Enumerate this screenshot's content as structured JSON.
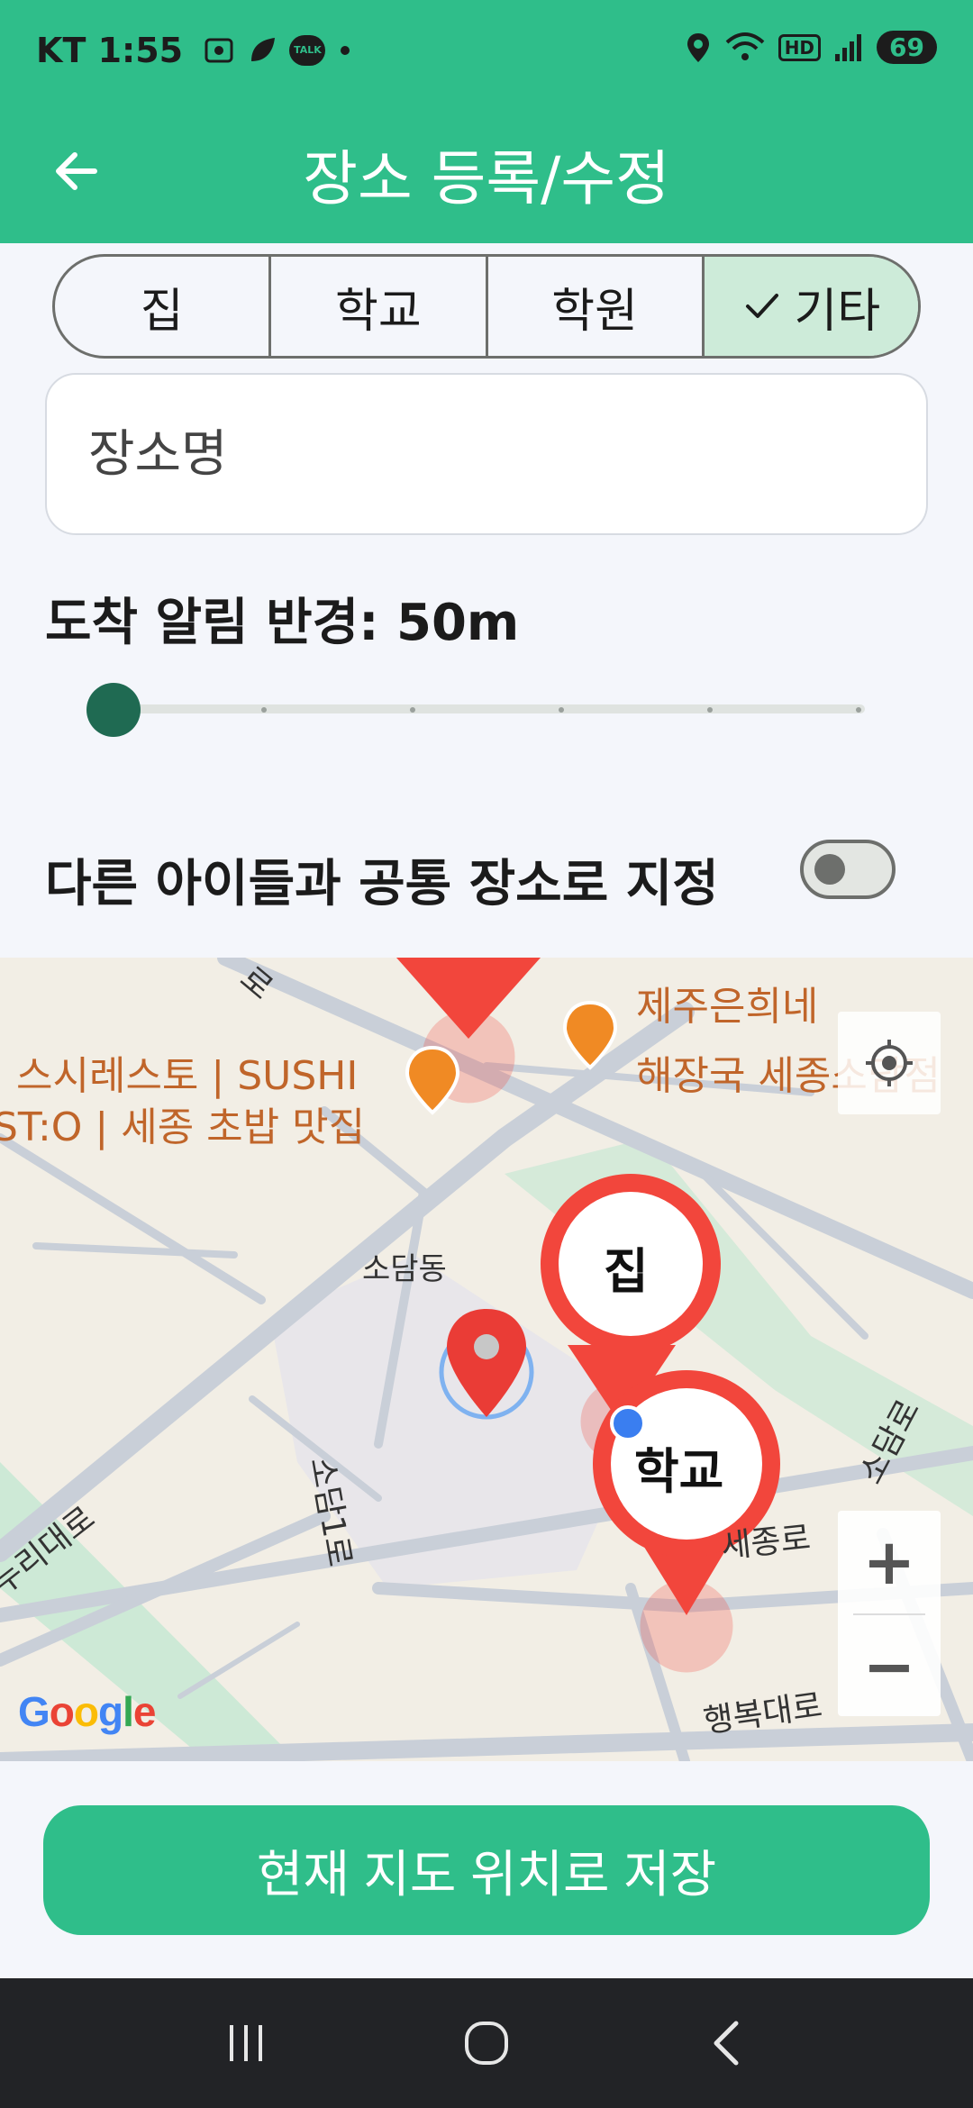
{
  "status_bar": {
    "carrier_time": "KT 1:55",
    "talk_badge": "TALK",
    "battery": "69",
    "hd_label": "HD"
  },
  "app_bar": {
    "title": "장소 등록/수정"
  },
  "segments": [
    {
      "label": "집",
      "selected": false
    },
    {
      "label": "학교",
      "selected": false
    },
    {
      "label": "학원",
      "selected": false
    },
    {
      "label": "기타",
      "selected": true
    }
  ],
  "name_field": {
    "placeholder": "장소명",
    "value": ""
  },
  "radius": {
    "label": "도착 알림 반경: 50m",
    "slider_fraction": 0.0
  },
  "share": {
    "label": "다른 아이들과 공통 장소로 지정",
    "enabled": false
  },
  "map": {
    "places": [
      {
        "name": "스시레스토 | SUSHI"
      },
      {
        "name": "ST:O | 세종 초밥 맛집"
      },
      {
        "name": "제주은희네"
      },
      {
        "name": "해장국 세종소담점"
      }
    ],
    "area_label": "소담동",
    "roads": [
      "소담1로",
      "누리대로",
      "세종로",
      "소담로",
      "행복대로",
      "로"
    ],
    "pins": [
      {
        "label": "집"
      },
      {
        "label": "학교"
      }
    ],
    "zoom_in": "+",
    "zoom_out": "−",
    "logo": "Google"
  },
  "save_button": {
    "label": "현재 지도 위치로 저장"
  },
  "colors": {
    "primary": "#2fbe8a",
    "selected_segment": "#cdebd9",
    "slider_thumb": "#1f6a52",
    "pin_red": "#f2463c",
    "poi_orange": "#f08a24"
  }
}
